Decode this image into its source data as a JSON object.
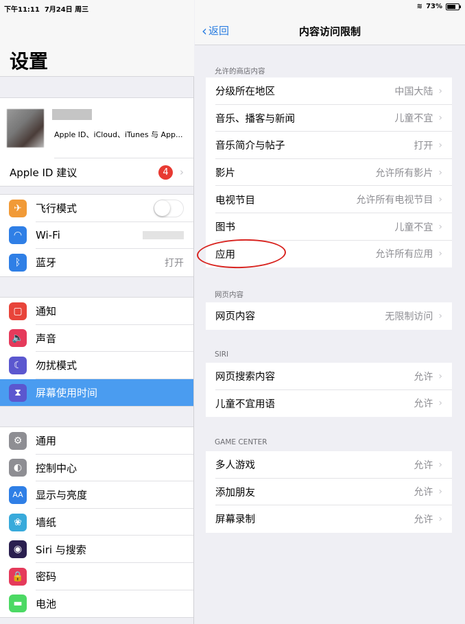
{
  "status_bar": {
    "time": "下午11:11",
    "date": "7月24日 周三",
    "battery": "73%",
    "battery_level": 0.73
  },
  "left": {
    "title": "设置",
    "profile": {
      "subtitle": "Apple ID、iCloud、iTunes 与 App..."
    },
    "apple_id_suggestion": {
      "label": "Apple ID 建议",
      "badge": "4"
    },
    "group1": [
      {
        "label": "飞行模式",
        "icon": "airplane-icon",
        "color": "#f19a37",
        "glyph": "✈",
        "toggle": false
      },
      {
        "label": "Wi-Fi",
        "icon": "wifi-icon",
        "color": "#2f7fe6",
        "glyph": "◠"
      },
      {
        "label": "蓝牙",
        "icon": "bluetooth-icon",
        "color": "#2f7fe6",
        "glyph": "ᛒ",
        "value": "打开"
      }
    ],
    "group2": [
      {
        "label": "通知",
        "icon": "notifications-icon",
        "color": "#e8443a",
        "glyph": "▢"
      },
      {
        "label": "声音",
        "icon": "sounds-icon",
        "color": "#e53a5b",
        "glyph": "🔈"
      },
      {
        "label": "勿扰模式",
        "icon": "moon-icon",
        "color": "#5b57cf",
        "glyph": "☾"
      },
      {
        "label": "屏幕使用时间",
        "icon": "hourglass-icon",
        "color": "#5b57cf",
        "glyph": "⧗",
        "selected": true
      }
    ],
    "group3": [
      {
        "label": "通用",
        "icon": "gear-icon",
        "color": "#8e8e93",
        "glyph": "⚙"
      },
      {
        "label": "控制中心",
        "icon": "control-center-icon",
        "color": "#8e8e93",
        "glyph": "◐"
      },
      {
        "label": "显示与亮度",
        "icon": "display-icon",
        "color": "#2f7fe6",
        "glyph": "AA"
      },
      {
        "label": "墙纸",
        "icon": "wallpaper-icon",
        "color": "#38aadb",
        "glyph": "❀"
      },
      {
        "label": "Siri 与搜索",
        "icon": "siri-icon",
        "color": "#2a1f4f",
        "glyph": "◉"
      },
      {
        "label": "密码",
        "icon": "lock-icon",
        "color": "#e53a5b",
        "glyph": "🔒"
      },
      {
        "label": "电池",
        "icon": "battery-icon",
        "color": "#4cd964",
        "glyph": "▬"
      }
    ]
  },
  "right": {
    "back": "返回",
    "title": "内容访问限制",
    "sections": [
      {
        "title": "允许的商店内容",
        "rows": [
          {
            "label": "分级所在地区",
            "value": "中国大陆"
          },
          {
            "label": "音乐、播客与新闻",
            "value": "儿童不宜"
          },
          {
            "label": "音乐简介与帖子",
            "value": "打开"
          },
          {
            "label": "影片",
            "value": "允许所有影片"
          },
          {
            "label": "电视节目",
            "value": "允许所有电视节目"
          },
          {
            "label": "图书",
            "value": "儿童不宜"
          },
          {
            "label": "应用",
            "value": "允许所有应用"
          }
        ]
      },
      {
        "title": "网页内容",
        "rows": [
          {
            "label": "网页内容",
            "value": "无限制访问"
          }
        ]
      },
      {
        "title": "SIRI",
        "rows": [
          {
            "label": "网页搜索内容",
            "value": "允许"
          },
          {
            "label": "儿童不宜用语",
            "value": "允许"
          }
        ]
      },
      {
        "title": "GAME CENTER",
        "rows": [
          {
            "label": "多人游戏",
            "value": "允许"
          },
          {
            "label": "添加朋友",
            "value": "允许"
          },
          {
            "label": "屏幕录制",
            "value": "允许"
          }
        ]
      }
    ]
  },
  "annotation": {
    "color": "#d8231f",
    "target": "应用"
  }
}
